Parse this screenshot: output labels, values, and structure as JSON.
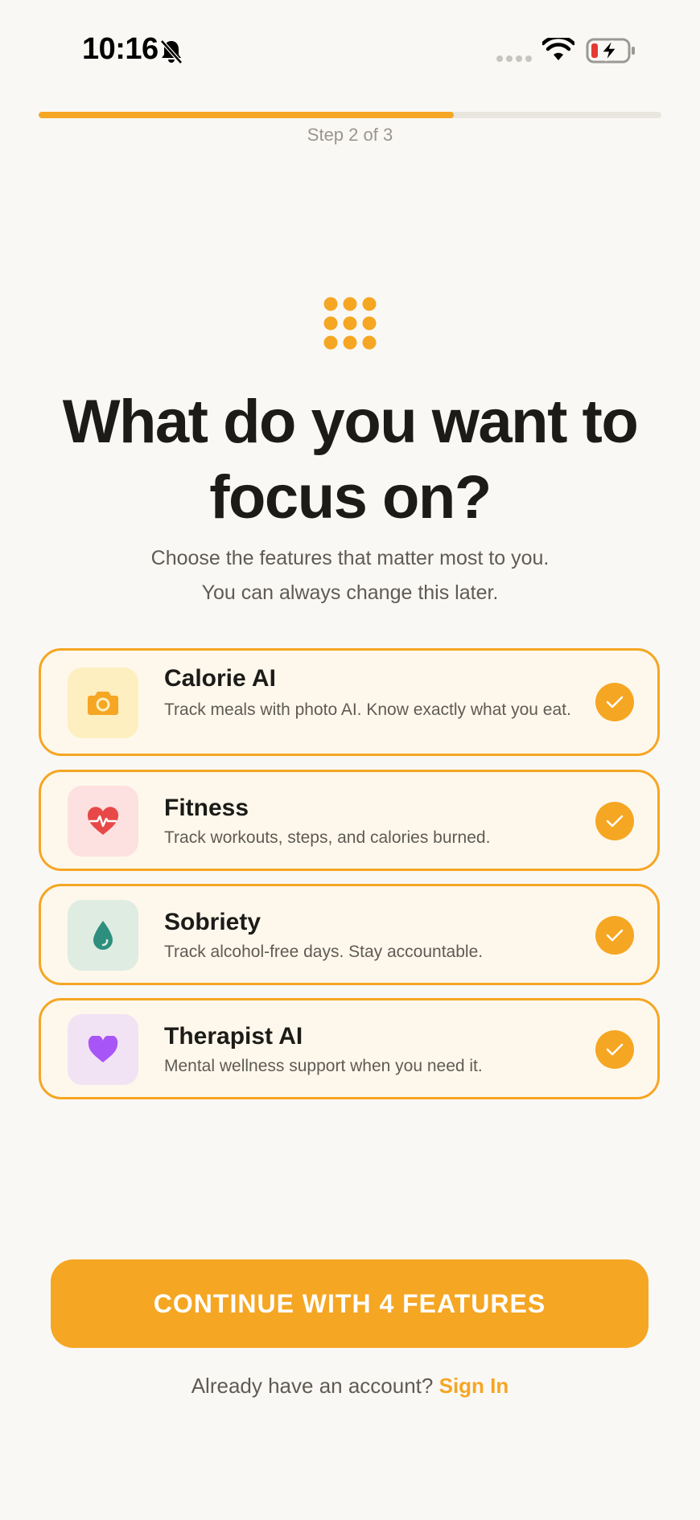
{
  "status_bar": {
    "time": "10:16",
    "icons": [
      "bell-slash-icon",
      "cellular-signal-icon",
      "wifi-icon",
      "battery-charging-icon"
    ]
  },
  "progress": {
    "label": "Step 2 of 3",
    "fraction": 0.667,
    "color": "#f5a623"
  },
  "header_icon": "grid-dots-icon",
  "headline": "What do you want to focus on?",
  "subtitle": {
    "line1": "Choose the features that matter most to you.",
    "line2": "You can always change this later."
  },
  "features": [
    {
      "title": "Calorie AI",
      "description": "Track meals with photo AI. Know exactly what you eat.",
      "icon": "camera-icon",
      "tile_color": "#fdefc0",
      "icon_color": "#f5a623",
      "selected": true
    },
    {
      "title": "Fitness",
      "description": "Track workouts, steps, and calories burned.",
      "icon": "heart-pulse-icon",
      "tile_color": "#fde0e0",
      "icon_color": "#e84848",
      "selected": true
    },
    {
      "title": "Sobriety",
      "description": "Track alcohol-free days. Stay accountable.",
      "icon": "water-drop-icon",
      "tile_color": "#dfece2",
      "icon_color": "#2e8f7e",
      "selected": true
    },
    {
      "title": "Therapist AI",
      "description": "Mental wellness support when you need it.",
      "icon": "heart-icon",
      "tile_color": "#f1e2f4",
      "icon_color": "#a855f7",
      "selected": true
    }
  ],
  "cta": {
    "label": "CONTINUE WITH 4 FEATURES"
  },
  "footer": {
    "prompt": "Already have an account?",
    "link": "Sign In"
  },
  "colors": {
    "accent": "#f5a623",
    "background": "#faf8f5",
    "card_background": "#fef8ec"
  }
}
